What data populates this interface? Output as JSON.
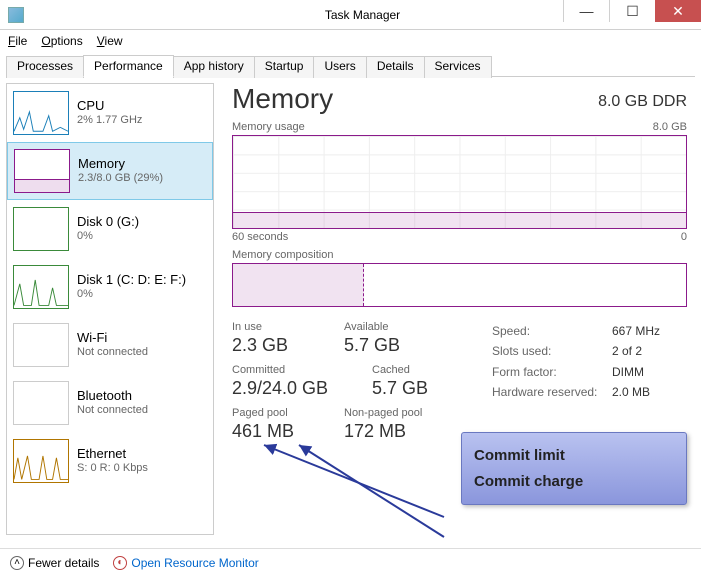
{
  "window": {
    "title": "Task Manager"
  },
  "menu": {
    "file": "File",
    "options": "Options",
    "view": "View"
  },
  "tabs": {
    "processes": "Processes",
    "performance": "Performance",
    "apphistory": "App history",
    "startup": "Startup",
    "users": "Users",
    "details": "Details",
    "services": "Services"
  },
  "sidebar": {
    "items": [
      {
        "title": "CPU",
        "sub": "2% 1.77 GHz"
      },
      {
        "title": "Memory",
        "sub": "2.3/8.0 GB (29%)"
      },
      {
        "title": "Disk 0 (G:)",
        "sub": "0%"
      },
      {
        "title": "Disk 1 (C: D: E: F:)",
        "sub": "0%"
      },
      {
        "title": "Wi-Fi",
        "sub": "Not connected"
      },
      {
        "title": "Bluetooth",
        "sub": "Not connected"
      },
      {
        "title": "Ethernet",
        "sub": "S: 0 R: 0 Kbps"
      }
    ]
  },
  "detail": {
    "heading": "Memory",
    "capacity": "8.0 GB DDR",
    "usage_label": "Memory usage",
    "usage_max": "8.0 GB",
    "axis_left": "60 seconds",
    "axis_right": "0",
    "comp_label": "Memory composition",
    "stats": {
      "inuse_label": "In use",
      "inuse": "2.3 GB",
      "avail_label": "Available",
      "avail": "5.7 GB",
      "committed_label": "Committed",
      "committed": "2.9/24.0 GB",
      "cached_label": "Cached",
      "cached": "5.7 GB",
      "paged_label": "Paged pool",
      "paged": "461 MB",
      "nonpaged_label": "Non-paged pool",
      "nonpaged": "172 MB"
    },
    "props": {
      "speed_k": "Speed:",
      "speed_v": "667 MHz",
      "slots_k": "Slots used:",
      "slots_v": "2 of 2",
      "form_k": "Form factor:",
      "form_v": "DIMM",
      "hw_k": "Hardware reserved:",
      "hw_v": "2.0 MB"
    }
  },
  "footer": {
    "fewer": "Fewer details",
    "monitor": "Open Resource Monitor"
  },
  "callout": {
    "line1": "Commit limit",
    "line2": "Commit charge"
  }
}
